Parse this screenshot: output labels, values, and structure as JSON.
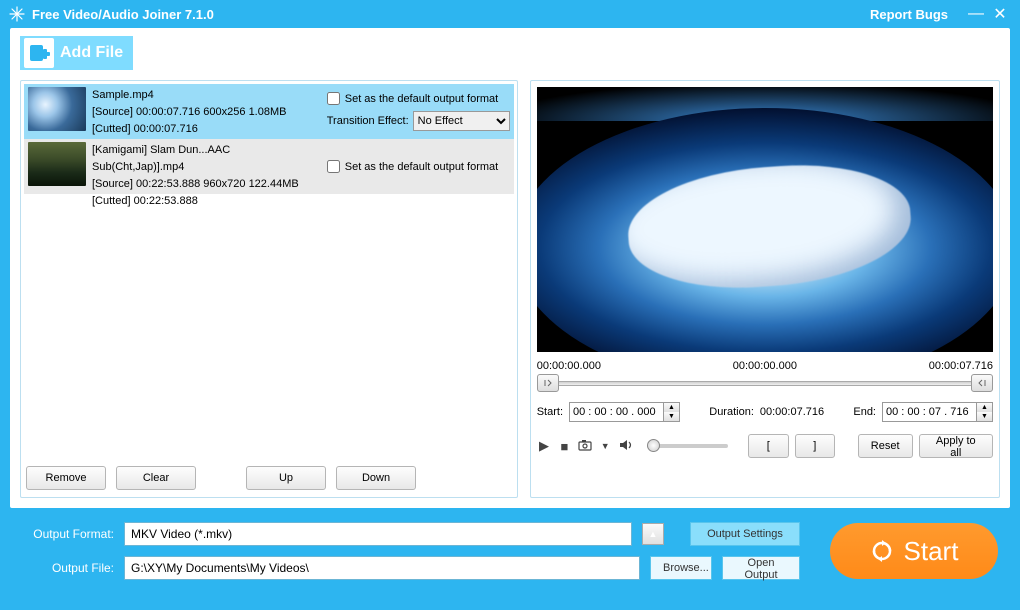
{
  "window": {
    "title": "Free Video/Audio Joiner 7.1.0",
    "report": "Report Bugs"
  },
  "toolbar": {
    "add_file": "Add File"
  },
  "files": [
    {
      "name": "Sample.mp4",
      "source_line": "[Source]  00:00:07.716  600x256  1.08MB",
      "cutted_line": "[Cutted]  00:00:07.716",
      "set_default": "Set as the default output format",
      "trans_label": "Transition Effect:",
      "trans_value": "No Effect"
    },
    {
      "name": "[Kamigami] Slam Dun...AAC Sub(Cht,Jap)].mp4",
      "source_line": "[Source]  00:22:53.888  960x720  122.44MB",
      "cutted_line": "[Cutted]  00:22:53.888",
      "set_default": "Set as the default output format"
    }
  ],
  "list_buttons": {
    "remove": "Remove",
    "clear": "Clear",
    "up": "Up",
    "down": "Down"
  },
  "preview": {
    "t_start_disp": "00:00:00.000",
    "t_cur": "00:00:00.000",
    "t_end_disp": "00:00:07.716",
    "start_label": "Start:",
    "start_value": "00 : 00 : 00 . 000",
    "duration_label": "Duration:",
    "duration_value": "00:00:07.716",
    "end_label": "End:",
    "end_value": "00 : 00 : 07 . 716",
    "reset": "Reset",
    "apply_all": "Apply to all"
  },
  "output": {
    "format_label": "Output Format:",
    "format_value": "MKV Video (*.mkv)",
    "settings": "Output Settings",
    "file_label": "Output File:",
    "file_value": "G:\\XY\\My Documents\\My Videos\\",
    "browse": "Browse...",
    "open": "Open Output"
  },
  "start": "Start"
}
